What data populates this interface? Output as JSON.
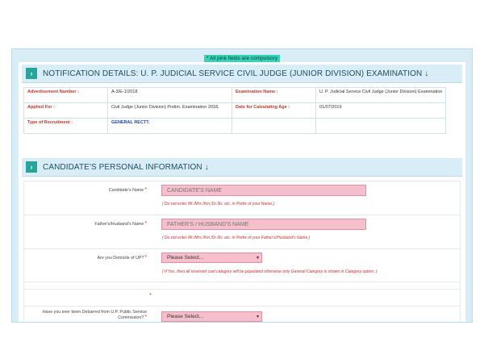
{
  "notice": "* All pink fields are compulsory",
  "notification": {
    "title": "NOTIFICATION DETAILS: U. P. JUDICIAL SERVICE CIVIL JUDGE (JUNIOR DIVISION) EXAMINATION ↓",
    "rows": [
      {
        "l1": "Advertisement Number :",
        "v1": "A-3/E-1/2018",
        "l2": "Examination Name :",
        "v2": "U. P. Judicial Service Civil Judge (Junior Division) Examination"
      },
      {
        "l1": "Applied For :",
        "v1": "Civil Judge (Junior Division) Prelim. Examination 2018,",
        "l2": "Date for Calculating Age :",
        "v2": "01/07/2019"
      },
      {
        "l1": "Type of Recruitment :",
        "v1": "GENERAL RECTT.",
        "l2": "",
        "v2": ""
      }
    ]
  },
  "personal": {
    "title": "CANDIDATE'S PERSONAL INFORMATION ↓",
    "name_label": "Candidate's Name",
    "name_placeholder": "CANDIDATE'S NAME",
    "name_hint": "( Do not enter Mr./Mrs./Km./Dr./Er. etc. in Prefix of your Name.)",
    "father_label": "Father's/Husband's Name",
    "father_placeholder": "FATHER'S / HUSBAND'S NAME",
    "father_hint": "( Do not enter Mr./Mrs./Km./Dr./Er. etc. in Prefix of your Father's/Husband's Name )",
    "domicile_label": "Are you Domicile of UP?",
    "domicile_value": "Please Select...",
    "domicile_hint": "( If Yes, then all reserved cast category will be populated otherwise only General Category is shown in Category option. )",
    "debarred_label": "Have you ever been Debarred from U.P. Public Service Commission?",
    "debarred_value": "Please Select...",
    "asterisk": "*"
  }
}
